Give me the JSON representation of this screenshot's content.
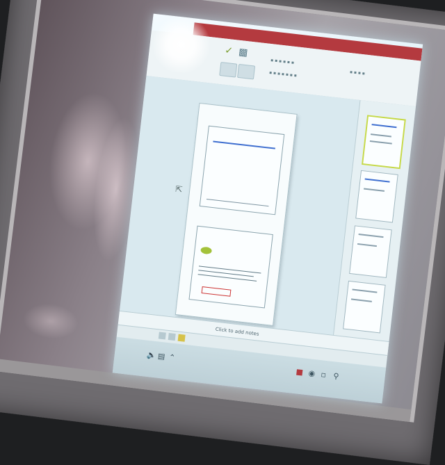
{
  "scene": {
    "description_tag": "photo-of-projected-presentation-editor",
    "colors": {
      "board": "#8a8088",
      "projection": "#d8ecf3",
      "title_bar": "#b43a3f",
      "slide_accent": "#3f6fd0",
      "thumb_highlight": "#c6d94a"
    }
  },
  "editor": {
    "ribbon": {
      "icons": [
        "paste-icon",
        "format-painter-icon"
      ],
      "labels": [
        "",
        ""
      ]
    },
    "slide1": {
      "title": "",
      "bullets": [
        "",
        ""
      ]
    },
    "slide2": {
      "title": "",
      "highlight": ""
    },
    "notes_placeholder": "Click to add notes",
    "thumbnails_count": 4,
    "active_thumbnail": 1
  },
  "taskbar": {
    "time": "",
    "date": ""
  }
}
